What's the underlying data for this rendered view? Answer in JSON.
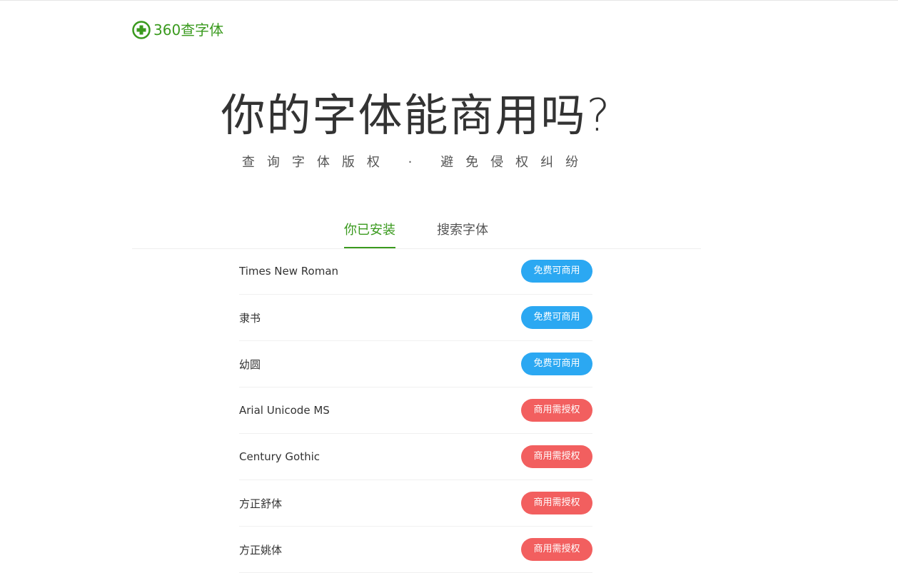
{
  "header": {
    "logo_text": "360查字体",
    "logo_icon": "medical-cross-icon",
    "brand_color": "#3a9a1e"
  },
  "hero": {
    "title": "你的字体能商用吗?",
    "subtitle": "查询字体版权 · 避免侵权纠纷"
  },
  "tabs": [
    {
      "label": "你已安装",
      "active": true
    },
    {
      "label": "搜索字体",
      "active": false
    }
  ],
  "fonts": [
    {
      "name": "Times New Roman",
      "license": "免费可商用",
      "status": "free"
    },
    {
      "name": "隶书",
      "license": "免费可商用",
      "status": "free"
    },
    {
      "name": "幼圆",
      "license": "免费可商用",
      "status": "free"
    },
    {
      "name": "Arial Unicode MS",
      "license": "商用需授权",
      "status": "paid"
    },
    {
      "name": "Century Gothic",
      "license": "商用需授权",
      "status": "paid"
    },
    {
      "name": "方正舒体",
      "license": "商用需授权",
      "status": "paid"
    },
    {
      "name": "方正姚体",
      "license": "商用需授权",
      "status": "paid"
    }
  ],
  "colors": {
    "free_badge": "#2ba8f2",
    "paid_badge": "#f25f5f",
    "active_tab": "#3a9a1e"
  }
}
